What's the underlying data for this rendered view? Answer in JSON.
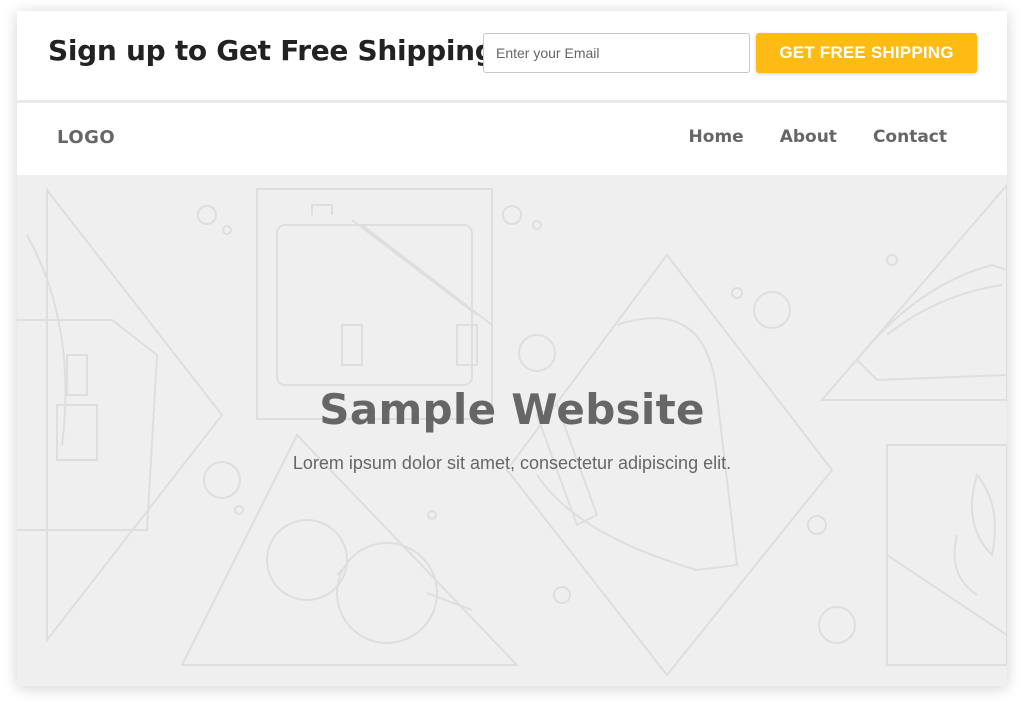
{
  "signup": {
    "title": "Sign up to Get Free Shipping!",
    "email_placeholder": "Enter your Email",
    "button_label": "GET FREE SHIPPING"
  },
  "nav": {
    "logo": "LOGO",
    "links": [
      {
        "label": "Home"
      },
      {
        "label": "About"
      },
      {
        "label": "Contact"
      }
    ]
  },
  "hero": {
    "title": "Sample Website",
    "subtitle": "Lorem ipsum dolor sit amet, consectetur adipiscing elit."
  },
  "colors": {
    "accent": "#fdbb13",
    "text_dark": "#222222",
    "text_muted": "#666666",
    "hero_bg": "#efefef"
  }
}
